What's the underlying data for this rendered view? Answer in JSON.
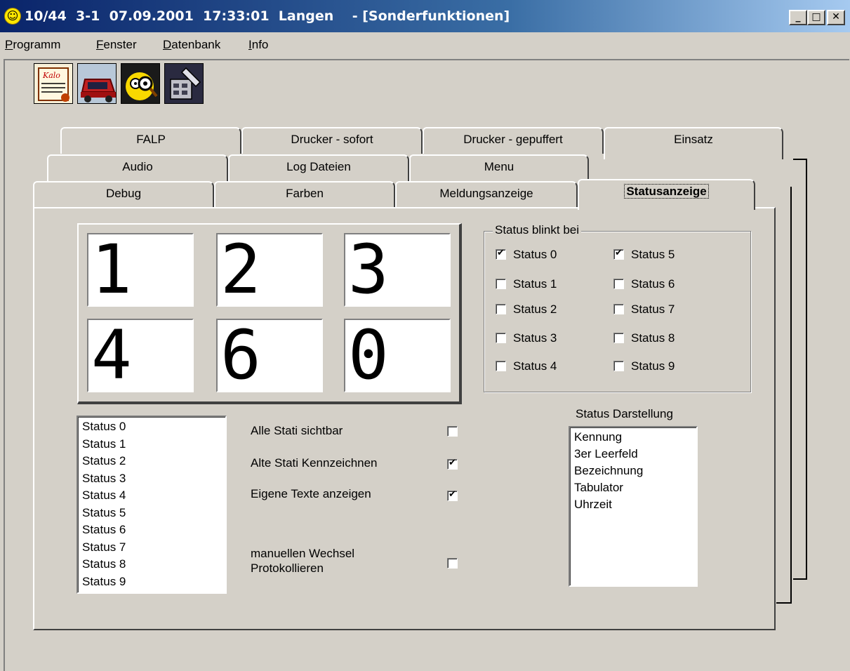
{
  "window": {
    "title": "10/44  3-1  07.09.2001  17:33:01  Langen    - [Sonderfunktionen]",
    "buttons": {
      "minimize": "_",
      "maximize": "□",
      "close": "✕"
    }
  },
  "menu": [
    {
      "label": "Programm",
      "ul": "P",
      "rest": "rogramm"
    },
    {
      "label": "Fenster",
      "ul": "F",
      "rest": "enster"
    },
    {
      "label": "Datenbank",
      "ul": "D",
      "rest": "atenbank"
    },
    {
      "label": "Info",
      "ul": "I",
      "rest": "nfo"
    }
  ],
  "toolbar_icons": [
    "document-icon",
    "car-icon",
    "search-face-icon",
    "tools-icon"
  ],
  "tabs": {
    "row1": [
      "FALP",
      "Drucker - sofort",
      "Drucker - gepuffert",
      "Einsatz"
    ],
    "row2": [
      "Audio",
      "Log Dateien",
      "Menu"
    ],
    "row3": [
      "Debug",
      "Farben",
      "Meldungsanzeige",
      "Statusanzeige"
    ],
    "active": "Statusanzeige"
  },
  "number_grid": [
    "1",
    "2",
    "3",
    "4",
    "6",
    "0"
  ],
  "status_blink": {
    "legend": "Status blinkt bei",
    "items": [
      {
        "label": "Status 0",
        "checked": true
      },
      {
        "label": "Status 1",
        "checked": false
      },
      {
        "label": "Status 2",
        "checked": false
      },
      {
        "label": "Status 3",
        "checked": false
      },
      {
        "label": "Status 4",
        "checked": false
      },
      {
        "label": "Status 5",
        "checked": true
      },
      {
        "label": "Status 6",
        "checked": false
      },
      {
        "label": "Status 7",
        "checked": false
      },
      {
        "label": "Status 8",
        "checked": false
      },
      {
        "label": "Status 9",
        "checked": false
      }
    ]
  },
  "status_list": [
    "Status 0",
    "Status 1",
    "Status 2",
    "Status 3",
    "Status 4",
    "Status 5",
    "Status 6",
    "Status 7",
    "Status 8",
    "Status 9"
  ],
  "options": [
    {
      "label": "Alle Stati sichtbar",
      "checked": false
    },
    {
      "label": "Alte Stati Kennzeichnen",
      "checked": true
    },
    {
      "label": "Eigene Texte anzeigen",
      "checked": true
    },
    {
      "label": "manuellen Wechsel\nProtokollieren",
      "checked": false
    }
  ],
  "darstellung": {
    "label": "Status Darstellung",
    "items": [
      "Kennung",
      "3er Leerfeld",
      "Bezeichnung",
      "Tabulator",
      "Uhrzeit"
    ]
  }
}
